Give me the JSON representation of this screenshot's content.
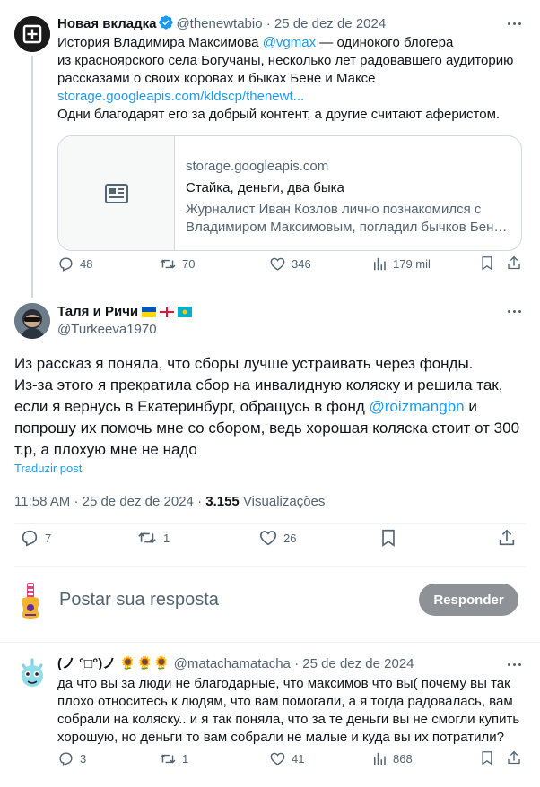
{
  "parent_tweet": {
    "name": "Новая вкладка",
    "handle": "@thenewtabio",
    "separator": "·",
    "date": "25 de dez de 2024",
    "body_line1_pre": "История Владимира Максимова ",
    "body_mention": "@vgmax",
    "body_line1_post": " — одинокого блогера",
    "body_line2": "из красноярского села Богучаны, несколько лет радовавшего аудиторию",
    "body_line3": "рассказами о своих коровах и быках Бене и Максе",
    "body_link": "storage.googleapis.com/kldscp/thenewt...",
    "body_line5": "Одни благодарят его за добрый контент, а другие считают аферистом.",
    "card": {
      "domain": "storage.googleapis.com",
      "title": "Стайка, деньги, два быка",
      "desc_line1": "Журналист Иван Козлов лично познакомился с",
      "desc_line2": "Владимиром Максимовым, погладил бычков Бене..."
    },
    "stats": {
      "replies": "48",
      "retweets": "70",
      "likes": "346",
      "views": "179 mil"
    }
  },
  "main_tweet": {
    "name": "Таля и Ричи",
    "handle": "@Turkeeva1970",
    "body_line1": "Из рассказ я поняла, что сборы лучше устраивать через фонды.",
    "body_line2": "Из-за этого я прекратила сбор на инвалидную коляску и решила так,",
    "body_line3": "если я вернусь в Екатеринбург, обращусь в фонд ",
    "body_mention": "@roizmangbn",
    "body_line3_post": " и",
    "body_line4": "попрошу их помочь мне со сбором, ведь хорошая коляска стоит от 300",
    "body_line5": "т.р, а плохую мне не надо",
    "translate": "Traduzir post",
    "time": "11:58 AM",
    "separator": "·",
    "date": "25 de dez de 2024",
    "views_count": "3.155",
    "views_label": "Visualizações",
    "stats": {
      "replies": "7",
      "retweets": "1",
      "likes": "26"
    }
  },
  "reply_box": {
    "placeholder": "Postar sua resposta",
    "button": "Responder"
  },
  "reply_tweet": {
    "name": "(ノ °□°)ノ 🌻🌻🌻",
    "handle": "@matachamatacha",
    "separator": "·",
    "date": "25 de dez de 2024",
    "body_line1": "да что вы за люди не благодарные, что максимов что вы( почему вы так",
    "body_line2": "плохо относитесь к людям, что вам помогали, а я тогда радовалась, вам",
    "body_line3": "собрали на коляску.. и я так поняла, что за те деньги вы не смогли купить",
    "body_line4": "хорошую, но деньги то вам собрали не малые и куда вы их потратили?",
    "stats": {
      "replies": "3",
      "retweets": "1",
      "likes": "41",
      "views": "868"
    }
  },
  "colors": {
    "accent": "#1d9bf0",
    "muted": "#536471",
    "border": "#cfd9de",
    "verified": "#1d9bf0"
  }
}
